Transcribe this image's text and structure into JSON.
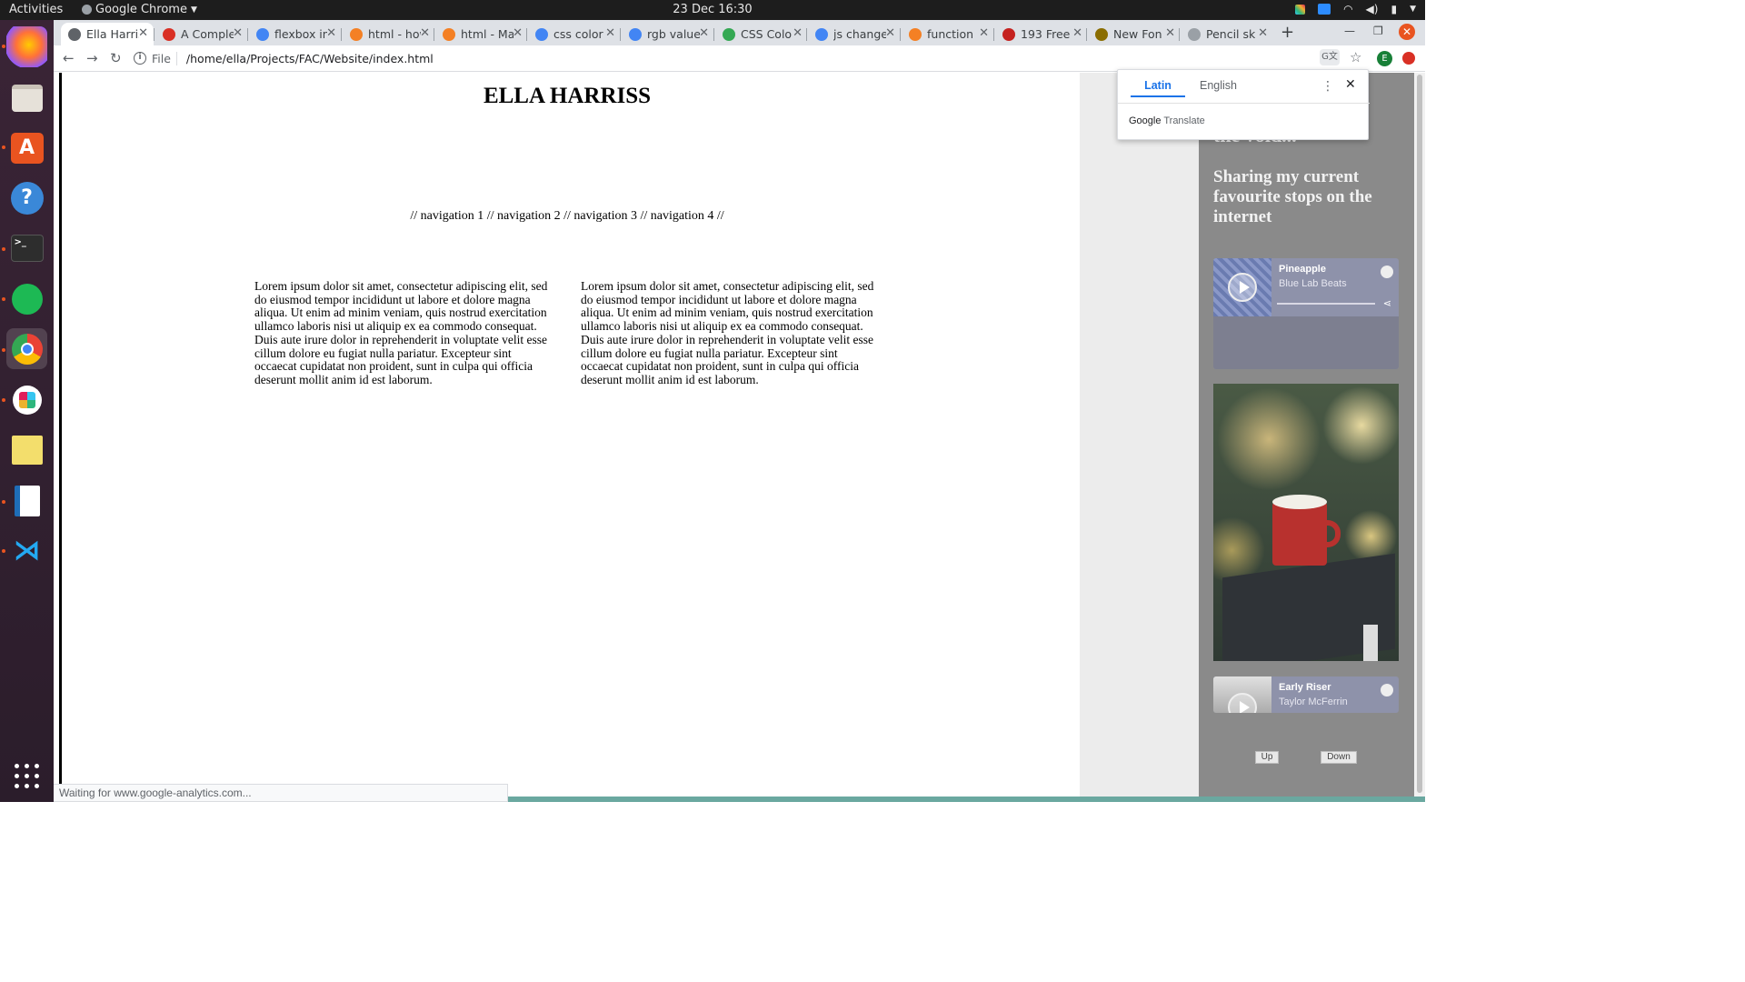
{
  "topbar": {
    "activities": "Activities",
    "app_name": "Google Chrome",
    "clock": "23 Dec  16:30"
  },
  "dock": {
    "items": [
      "Firefox",
      "Files",
      "Ubuntu Software",
      "Help",
      "Terminal",
      "Spotify",
      "Google Chrome",
      "Slack",
      "Sticky Notes",
      "LibreOffice Writer",
      "Visual Studio Code"
    ]
  },
  "tabs": [
    {
      "title": "Ella Harriss",
      "color": "#5f6368"
    },
    {
      "title": "A Complete",
      "color": "#d93025"
    },
    {
      "title": "flexbox in",
      "color": "#4285f4"
    },
    {
      "title": "html - how",
      "color": "#f48024"
    },
    {
      "title": "html - Ma",
      "color": "#f48024"
    },
    {
      "title": "css color",
      "color": "#4285f4"
    },
    {
      "title": "rgb value",
      "color": "#4285f4"
    },
    {
      "title": "CSS Colo",
      "color": "#34a853"
    },
    {
      "title": "js change",
      "color": "#4285f4"
    },
    {
      "title": "function",
      "color": "#f48024"
    },
    {
      "title": "193 Free",
      "color": "#c5221f"
    },
    {
      "title": "New Fon",
      "color": "#8a6d00"
    },
    {
      "title": "Pencil sk",
      "color": "#9aa0a6"
    }
  ],
  "omnibox": {
    "scheme_label": "File",
    "url": "/home/ella/Projects/FAC/Website/index.html"
  },
  "profile_initial": "E",
  "page": {
    "title": "ELLA HARRISS",
    "nav": "// navigation 1 // navigation 2 // navigation 3 // navigation 4 //",
    "column_left": "Lorem ipsum dolor sit amet, consectetur adipiscing elit, sed do eiusmod tempor incididunt ut labore et dolore magna aliqua. Ut enim ad minim veniam, quis nostrud exercitation ullamco laboris nisi ut aliquip ex ea commodo consequat. Duis aute irure dolor in reprehenderit in voluptate velit esse cillum dolore eu fugiat nulla pariatur. Excepteur sint occaecat cupidatat non proident, sunt in culpa qui officia deserunt mollit anim id est laborum.",
    "column_right": "Lorem ipsum dolor sit amet, consectetur adipiscing elit, sed do eiusmod tempor incididunt ut labore et dolore magna aliqua. Ut enim ad minim veniam, quis nostrud exercitation ullamco laboris nisi ut aliquip ex ea commodo consequat. Duis aute irure dolor in reprehenderit in voluptate velit esse cillum dolore eu fugiat nulla pariatur. Excepteur sint occaecat cupidatat non proident, sunt in culpa qui officia deserunt mollit anim id est laborum."
  },
  "panel": {
    "void_text": "the void...",
    "heading": "Sharing my current favourite stops on the internet",
    "spotify_cards": [
      {
        "track": "Pineapple",
        "artist": "Blue Lab Beats"
      },
      {
        "track": "Early Riser",
        "artist": "Taylor McFerrin"
      }
    ],
    "up_label": "Up",
    "down_label": "Down"
  },
  "translate_popup": {
    "source_lang": "Latin",
    "target_lang": "English",
    "brand_google": "Google",
    "brand_translate": "Translate"
  },
  "status_text": "Waiting for www.google-analytics.com...",
  "colors": {
    "ubuntu_orange": "#e95420",
    "translate_blue": "#1a73e8",
    "dock_bg": "#2b1d2b"
  }
}
